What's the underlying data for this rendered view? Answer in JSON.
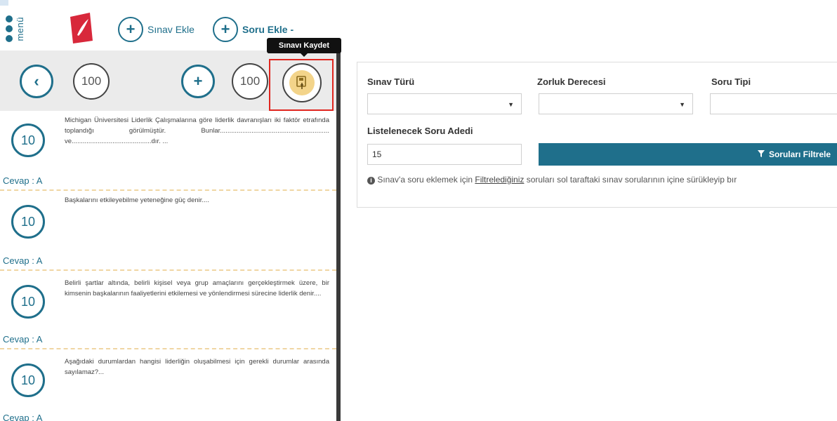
{
  "header": {
    "menu_label": "menü",
    "add_exam_label": "Sınav Ekle",
    "add_question_label": "Soru Ekle -",
    "tooltip": "Sınavı Kaydet"
  },
  "toolbar": {
    "left_count": "100",
    "right_count": "100"
  },
  "questions": [
    {
      "points": "10",
      "text": "Michigan Üniversitesi Liderlik Çalışmalarına göre liderlik davranışları iki faktör etrafında toplandığı görülmüştür. Bunlar........................................................... ve...........................................dır. ...",
      "answer": "Cevap : A"
    },
    {
      "points": "10",
      "text": "Başkalarını etkileyebilme yeteneğine güç denir....",
      "answer": "Cevap : A"
    },
    {
      "points": "10",
      "text": "Belirli şartlar altında, belirli kişisel veya grup amaçlarını gerçekleştirmek üzere, bir kimsenin başkalarının faaliyetlerini etkilemesi ve yönlendirmesi sürecine liderlik denir....",
      "answer": "Cevap : A"
    },
    {
      "points": "10",
      "text": "Aşağıdaki durumlardan hangisi liderliğin oluşabilmesi için gerekli durumlar arasında sayılamaz?...",
      "answer": "Cevap : A"
    }
  ],
  "filters": {
    "exam_type_label": "Sınav Türü",
    "difficulty_label": "Zorluk Derecesi",
    "question_type_label": "Soru Tipi",
    "count_label": "Listelenecek Soru Adedi",
    "count_value": "15",
    "filter_button": "Soruları Filtrele",
    "info_prefix": "Sınav'a soru eklemek için ",
    "info_link": "Filtrelediğiniz",
    "info_suffix": " soruları sol taraftaki sınav sorularının içine sürükleyip bır"
  },
  "colors": {
    "accent": "#1f6f8b",
    "highlight": "#e0261f",
    "save_fill": "#f3d48a"
  }
}
